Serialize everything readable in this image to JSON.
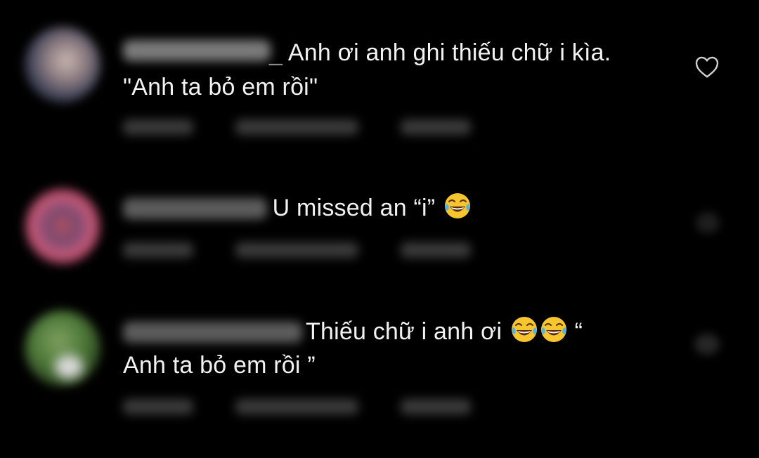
{
  "comments": [
    {
      "username_suffix": "_",
      "line1": " Anh ơi anh ghi thiếu chữ i kìa.",
      "line2": "\"Anh ta bỏ em rồi\"",
      "liked_icon": "heart-outline-icon"
    },
    {
      "line1": " U missed an “i” ",
      "emoji_count": 1,
      "emoji": "face-with-tears-of-joy"
    },
    {
      "line1": " Thiếu chữ i anh ơi ",
      "line1_tail": " “",
      "line2": "Anh ta bỏ em rồi ”",
      "emoji_count": 2,
      "emoji": "face-with-tears-of-joy"
    }
  ],
  "colors": {
    "background": "#000000",
    "text": "#f2f2f2",
    "heart_stroke": "#cfcfcf"
  }
}
